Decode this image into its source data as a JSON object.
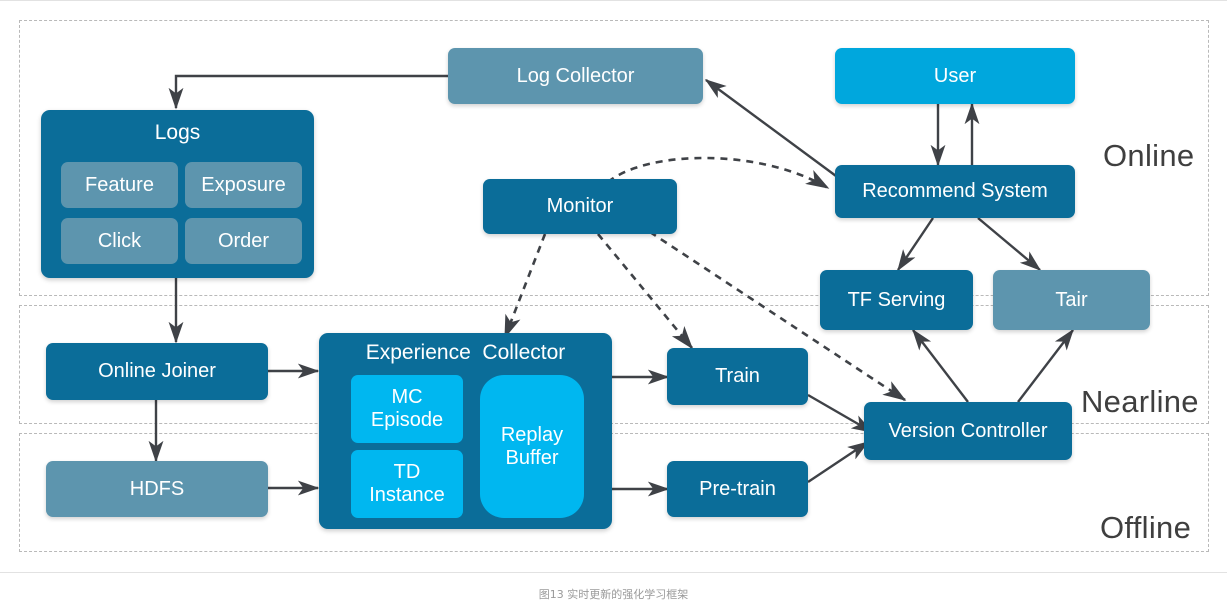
{
  "diagram": {
    "caption": "图13 实时更新的强化学习框架",
    "zones": [
      {
        "id": "online",
        "label": "Online"
      },
      {
        "id": "nearline",
        "label": "Nearline"
      },
      {
        "id": "offline",
        "label": "Offline"
      }
    ],
    "nodes": {
      "log_collector": "Log Collector",
      "user": "User",
      "recommend_system": "Recommend System",
      "monitor": "Monitor",
      "tf_serving": "TF Serving",
      "tair": "Tair",
      "online_joiner": "Online Joiner",
      "hdfs": "HDFS",
      "train": "Train",
      "pre_train": "Pre-train",
      "version_controller": "Version Controller"
    },
    "groups": {
      "logs": {
        "title": "Logs",
        "chips": [
          "Feature",
          "Exposure",
          "Click",
          "Order"
        ]
      },
      "experience_collector": {
        "title": "Experience  Collector",
        "chips": [
          "MC\nEpisode",
          "TD\nInstance",
          "Replay\nBuffer"
        ]
      }
    },
    "colors": {
      "dark_blue": "#0b6d99",
      "steel_blue": "#5d95ae",
      "cyan": "#00a7dd",
      "light_cyan": "#00b7f0",
      "arrow": "#3f4247",
      "zone_border": "#b9b9b9",
      "zone_label": "#3f3f3f",
      "caption": "#9a9a9a"
    }
  }
}
